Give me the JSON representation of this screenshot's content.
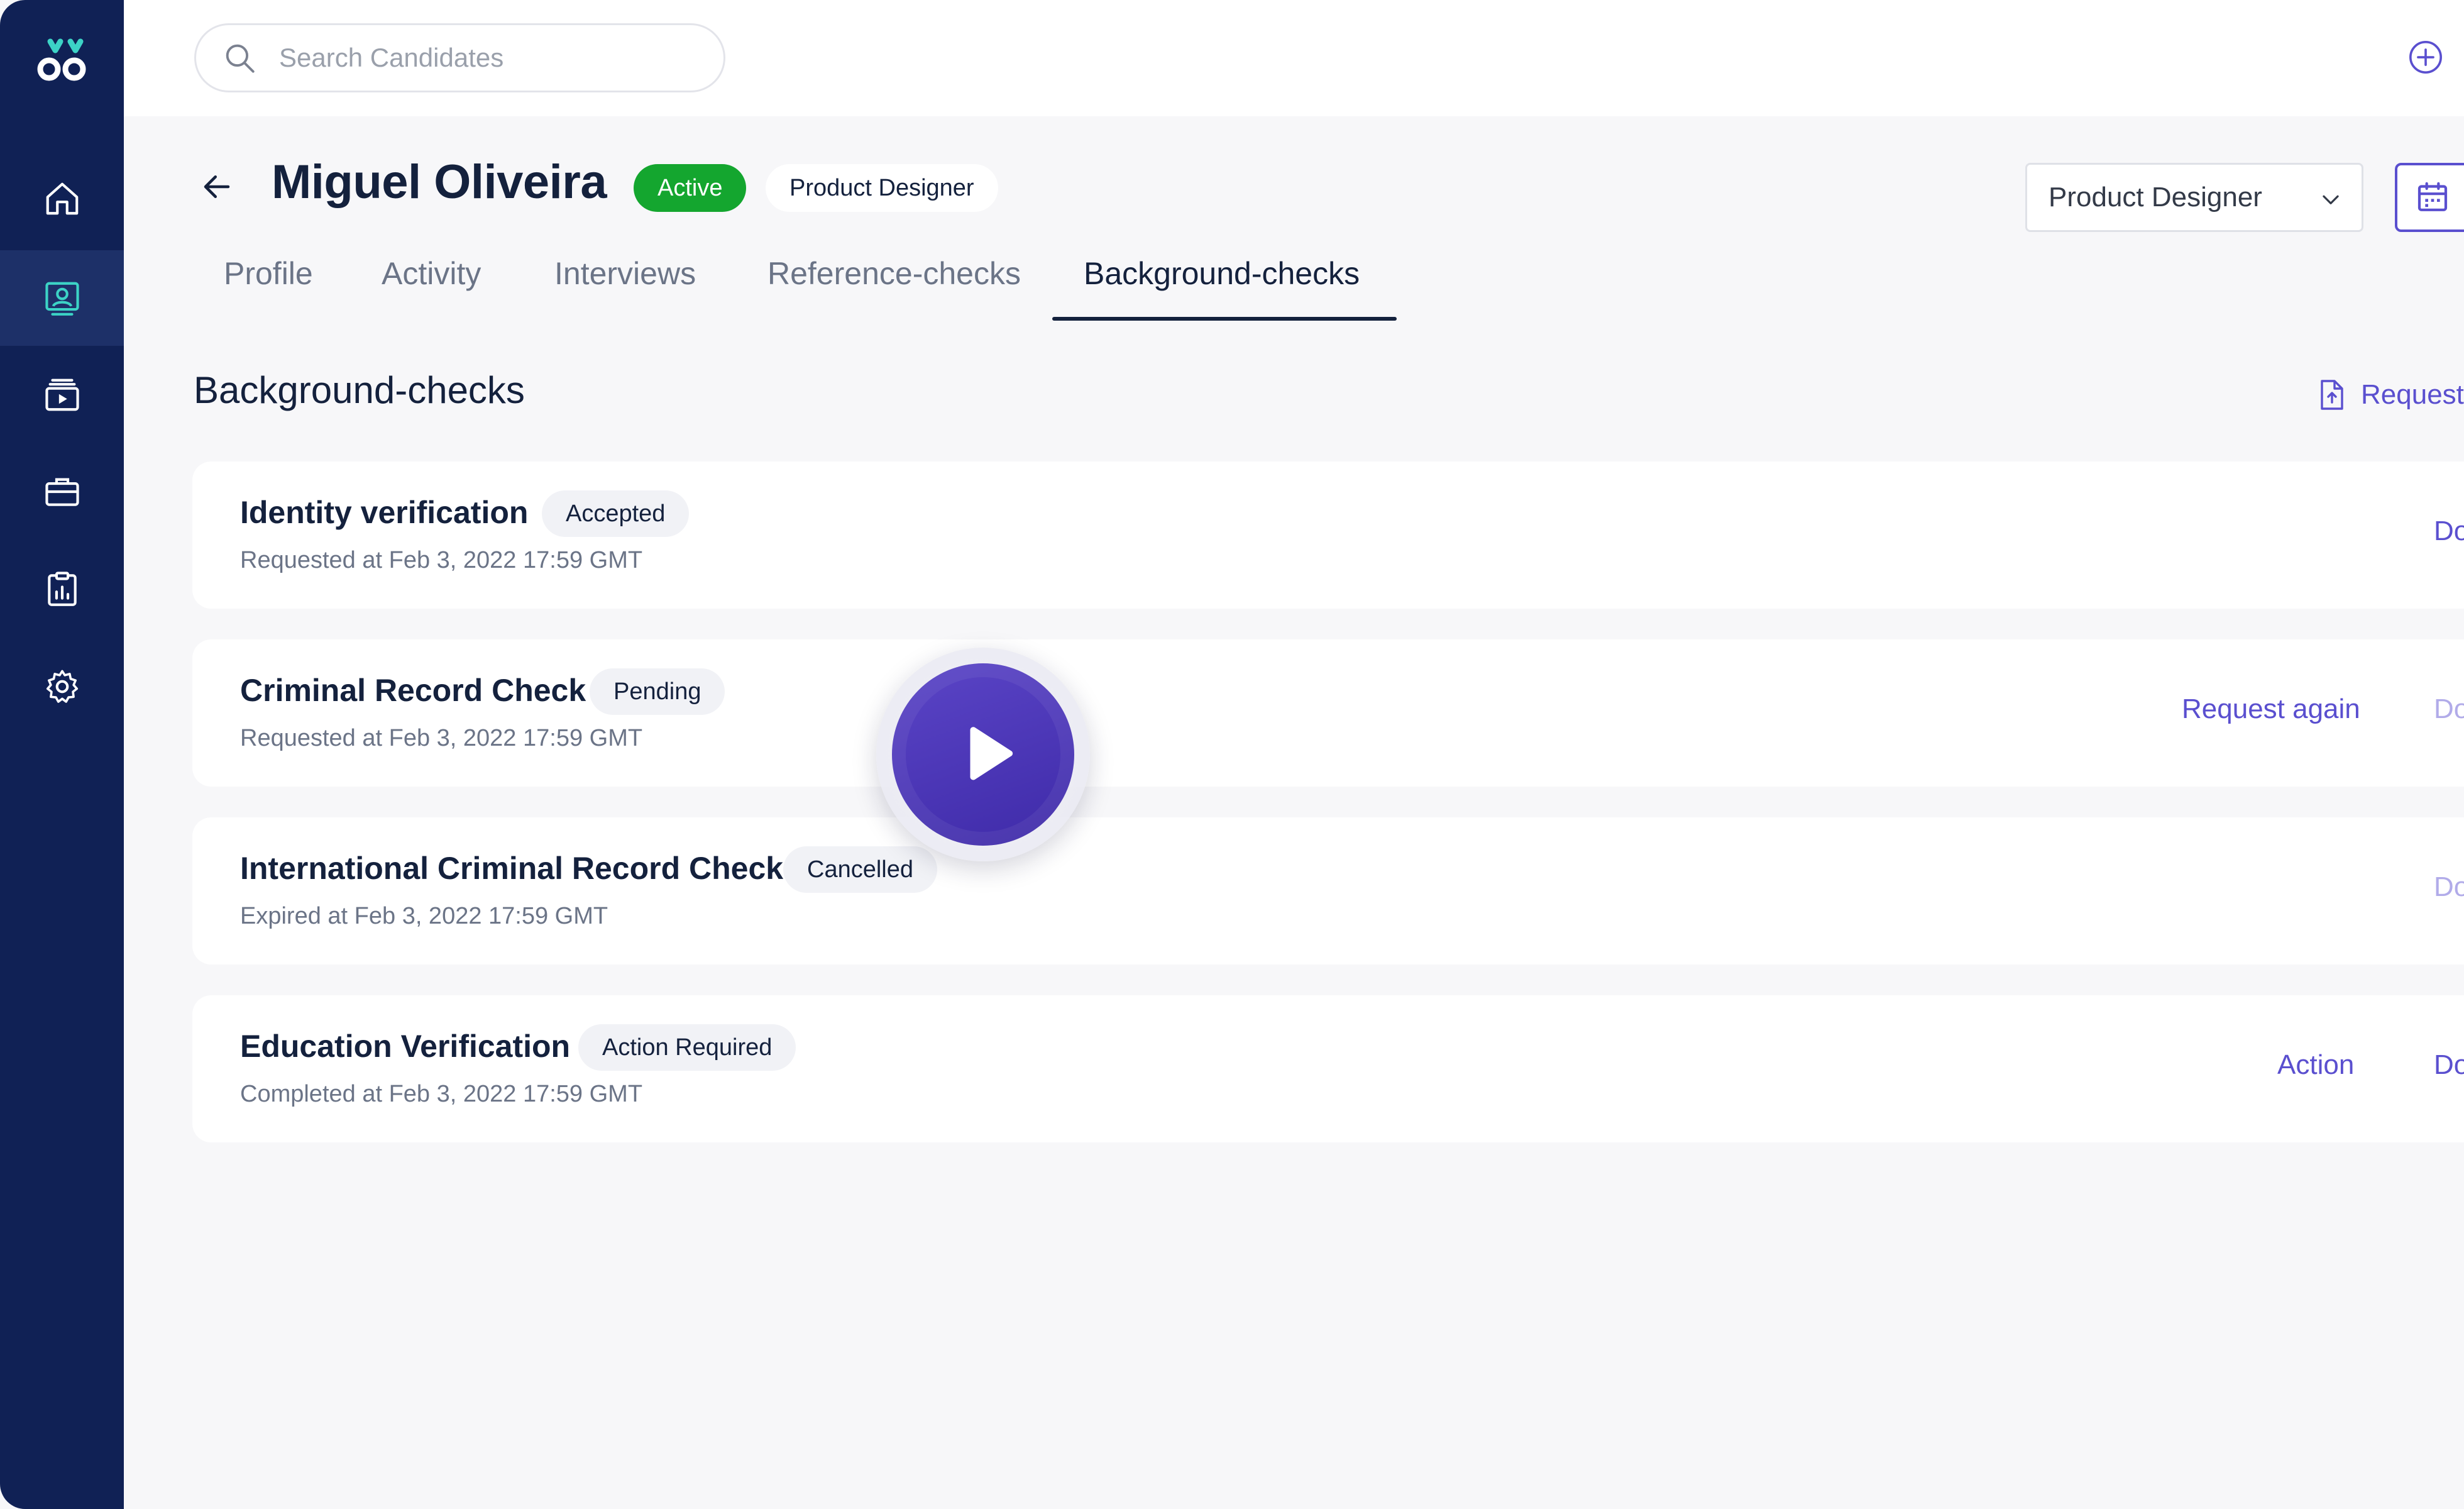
{
  "colors": {
    "sidebar_bg": "#102155",
    "sidebar_active": "#1d3068",
    "accent": "#5a4fcf",
    "active_green": "#14a62f",
    "logo_teal": "#3cd3c6"
  },
  "sidebar": {
    "items": [
      {
        "name": "home",
        "icon": "home-icon"
      },
      {
        "name": "candidates",
        "icon": "candidate-card-icon",
        "active": true
      },
      {
        "name": "interviews",
        "icon": "video-stack-icon"
      },
      {
        "name": "jobs",
        "icon": "briefcase-icon"
      },
      {
        "name": "reports",
        "icon": "clipboard-chart-icon"
      },
      {
        "name": "settings",
        "icon": "gear-icon"
      }
    ]
  },
  "search": {
    "placeholder": "Search Candidates"
  },
  "candidate": {
    "name": "Miguel Oliveira",
    "status": "Active",
    "role": "Product Designer"
  },
  "role_select": {
    "value": "Product Designer"
  },
  "tabs": [
    {
      "label": "Profile"
    },
    {
      "label": "Activity"
    },
    {
      "label": "Interviews"
    },
    {
      "label": "Reference-checks"
    },
    {
      "label": "Background-checks",
      "active": true
    }
  ],
  "section": {
    "title": "Background-checks",
    "request_label": "Request"
  },
  "checks": [
    {
      "title": "Identity verification",
      "status": "Accepted",
      "subtitle": "Requested at Feb 3, 2022 17:59 GMT",
      "action": "",
      "doc": "Do"
    },
    {
      "title": "Criminal Record Check",
      "status": "Pending",
      "subtitle": "Requested at Feb 3, 2022 17:59 GMT",
      "action": "Request again",
      "doc": "Do"
    },
    {
      "title": "International Criminal Record Check",
      "status": "Cancelled",
      "subtitle": "Expired at Feb 3, 2022 17:59 GMT",
      "action": "",
      "doc": "Do"
    },
    {
      "title": "Education Verification",
      "status": "Action Required",
      "subtitle": "Completed at Feb 3, 2022 17:59 GMT",
      "action": "Action",
      "doc": "Do"
    }
  ]
}
